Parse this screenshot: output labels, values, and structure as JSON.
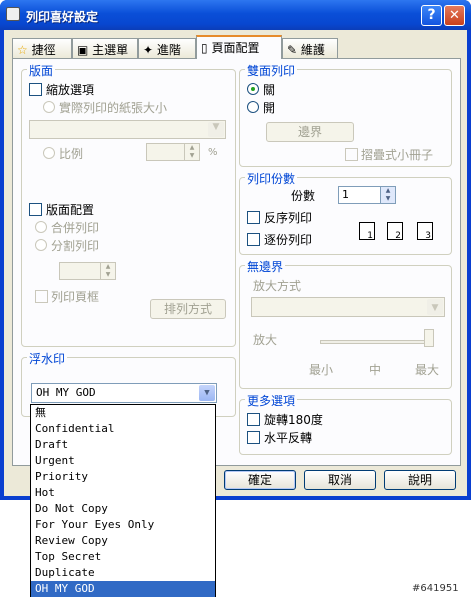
{
  "window": {
    "title": "列印喜好設定",
    "help": "?",
    "close": "✕"
  },
  "tabs": [
    "捷徑",
    "主選單",
    "進階",
    "頁面配置",
    "維護"
  ],
  "layout_group": {
    "title": "版面",
    "scale_option": "縮放選項",
    "fit_paper": "實際列印的紙張大小",
    "ratio": "比例",
    "percent": "%",
    "page_layout": "版面配置",
    "merge_print": "合併列印",
    "split_print": "分割列印",
    "print_border": "列印頁框",
    "arrange_button": "排列方式"
  },
  "duplex_group": {
    "title": "雙面列印",
    "off": "關",
    "on": "開",
    "margin_button": "邊界",
    "booklet": "摺疊式小冊子"
  },
  "copies_group": {
    "title": "列印份數",
    "copies_label": "份數",
    "copies_value": "1",
    "reverse": "反序列印",
    "collate": "逐份列印",
    "collate_icons": [
      "1",
      "2",
      "3"
    ]
  },
  "borderless_group": {
    "title": "無邊界",
    "method_label": "放大方式",
    "enlarge_label": "放大",
    "min": "最小",
    "mid": "中",
    "max": "最大"
  },
  "watermark_group": {
    "title": "浮水印",
    "selected": "OH MY GOD"
  },
  "more_group": {
    "title": "更多選項",
    "rotate": "旋轉180度",
    "mirror": "水平反轉"
  },
  "watermark_options": [
    "無",
    "Confidential",
    "Draft",
    "Urgent",
    "Priority",
    "Hot",
    "Do Not Copy",
    "For Your Eyes Only",
    "Review Copy",
    "Top Secret",
    "Duplicate",
    "OH MY GOD"
  ],
  "dialog_buttons": {
    "ok": "確定",
    "cancel": "取消",
    "help": "說明"
  },
  "watermark_stamp": "#641951",
  "colors": {
    "titlebar": "#0a4fd8",
    "group_title": "#0046d5",
    "selection": "#316ac5",
    "active_tab": "#e68b2c"
  }
}
